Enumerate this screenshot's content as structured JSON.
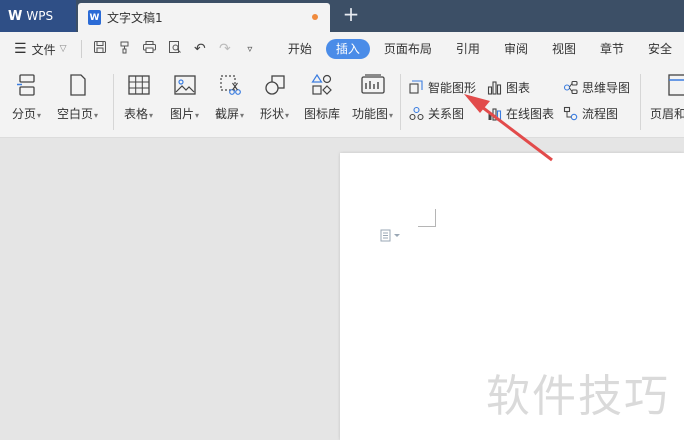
{
  "app": {
    "name": "WPS"
  },
  "doc_tab": {
    "title": "文字文稿1",
    "icon_letter": "W"
  },
  "new_tab": "+",
  "menu": {
    "file_label": "文件",
    "tabs": [
      "开始",
      "插入",
      "页面布局",
      "引用",
      "审阅",
      "视图",
      "章节",
      "安全"
    ],
    "active_tab": "插入"
  },
  "ribbon": {
    "page_break": "分页",
    "blank_page": "空白页",
    "table": "表格",
    "picture": "图片",
    "screenshot": "截屏",
    "shape": "形状",
    "icon_lib": "图标库",
    "function_chart": "功能图",
    "smart_shape": "智能图形",
    "relation_chart": "关系图",
    "chart": "图表",
    "online_chart": "在线图表",
    "mind_map": "思维导图",
    "flowchart": "流程图",
    "header_footer": "页眉和"
  },
  "watermark": "软件技巧",
  "colors": {
    "accent": "#4a8ce8",
    "titlebar": "#3c4f66",
    "wps_tab": "#2f4f86",
    "arrow": "#e24b4b"
  }
}
